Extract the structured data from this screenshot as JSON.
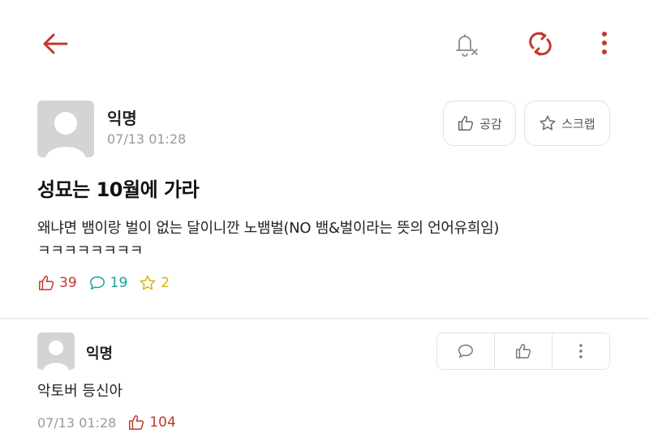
{
  "colors": {
    "accent": "#c0392b",
    "comment_icon": "#1aa0a0",
    "scrap_icon": "#d4b400",
    "muted": "#9a9a9a"
  },
  "topbar": {
    "icons": [
      "back-arrow-icon",
      "bell-off-icon",
      "refresh-icon",
      "more-vertical-icon"
    ]
  },
  "post": {
    "author": "익명",
    "date": "07/13 01:28",
    "like_label": "공감",
    "scrap_label": "스크랩",
    "title": "성묘는 10월에 가라",
    "body_line1": "왜냐면 뱀이랑 벌이 없는 달이니깐 노뱀벌(NO 뱀&벌이라는 뜻의 언어유희임)",
    "body_line2": "ㅋㅋㅋㅋㅋㅋㅋㅋ",
    "stats": {
      "likes": "39",
      "comments": "19",
      "scraps": "2"
    }
  },
  "comment": {
    "author": "익명",
    "text": "악토버 등신아",
    "date": "07/13 01:28",
    "likes": "104"
  }
}
